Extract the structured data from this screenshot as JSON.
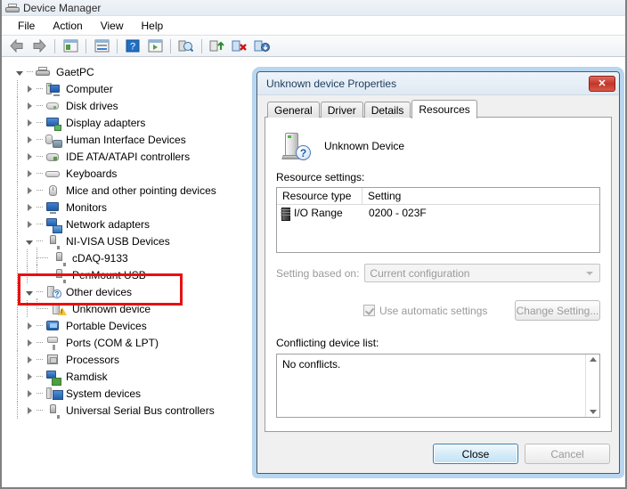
{
  "window": {
    "title": "Device Manager",
    "icon": "printer-device-icon",
    "menus": [
      "File",
      "Action",
      "View",
      "Help"
    ],
    "toolbar": [
      {
        "name": "back-button",
        "icon": "left-arrow-icon"
      },
      {
        "name": "forward-button",
        "icon": "right-arrow-icon"
      },
      {
        "name": "separator-1",
        "icon": "separator"
      },
      {
        "name": "show-hide-console-tree-button",
        "icon": "console-tree-icon"
      },
      {
        "name": "separator-2",
        "icon": "separator"
      },
      {
        "name": "properties-button",
        "icon": "properties-window-icon"
      },
      {
        "name": "separator-3",
        "icon": "separator"
      },
      {
        "name": "help-button",
        "icon": "help-question-icon"
      },
      {
        "name": "show-hide-action-pane-button",
        "icon": "action-pane-icon"
      },
      {
        "name": "separator-4",
        "icon": "separator"
      },
      {
        "name": "scan-for-hardware-changes-button",
        "icon": "scan-magnifier-icon"
      },
      {
        "name": "separator-5",
        "icon": "separator"
      },
      {
        "name": "update-driver-button",
        "icon": "update-driver-icon"
      },
      {
        "name": "uninstall-device-button",
        "icon": "uninstall-device-icon"
      },
      {
        "name": "disable-device-button",
        "icon": "disable-device-icon"
      }
    ]
  },
  "tree": {
    "root": {
      "label": "GaetPC",
      "icon": "computer-printer-icon",
      "expanded": true
    },
    "items": [
      {
        "label": "Computer",
        "icon": "computer-icon",
        "state": "collapsed",
        "level": 1
      },
      {
        "label": "Disk drives",
        "icon": "disk-drive-icon",
        "state": "collapsed",
        "level": 1
      },
      {
        "label": "Display adapters",
        "icon": "display-adapter-icon",
        "state": "collapsed",
        "level": 1
      },
      {
        "label": "Human Interface Devices",
        "icon": "hid-icon",
        "state": "collapsed",
        "level": 1
      },
      {
        "label": "IDE ATA/ATAPI controllers",
        "icon": "ide-controller-icon",
        "state": "collapsed",
        "level": 1
      },
      {
        "label": "Keyboards",
        "icon": "keyboard-icon",
        "state": "collapsed",
        "level": 1
      },
      {
        "label": "Mice and other pointing devices",
        "icon": "mouse-icon",
        "state": "collapsed",
        "level": 1
      },
      {
        "label": "Monitors",
        "icon": "monitor-icon",
        "state": "collapsed",
        "level": 1
      },
      {
        "label": "Network adapters",
        "icon": "network-adapter-icon",
        "state": "collapsed",
        "level": 1
      },
      {
        "label": "NI-VISA USB Devices",
        "icon": "usb-device-icon",
        "state": "expanded",
        "level": 1
      },
      {
        "label": "cDAQ-9133",
        "icon": "usb-device-icon",
        "state": "leaf",
        "level": 2
      },
      {
        "label": "PenMount USB",
        "icon": "usb-device-icon",
        "state": "leaf-last",
        "level": 2
      },
      {
        "label": "Other devices",
        "icon": "other-device-question-icon",
        "state": "expanded",
        "level": 1,
        "highlighted": true
      },
      {
        "label": "Unknown device",
        "icon": "unknown-device-warning-icon",
        "state": "leaf-last",
        "level": 2,
        "highlighted": true
      },
      {
        "label": "Portable Devices",
        "icon": "portable-device-icon",
        "state": "collapsed",
        "level": 1
      },
      {
        "label": "Ports (COM & LPT)",
        "icon": "port-icon",
        "state": "collapsed",
        "level": 1
      },
      {
        "label": "Processors",
        "icon": "processor-icon",
        "state": "collapsed",
        "level": 1
      },
      {
        "label": "Ramdisk",
        "icon": "ramdisk-icon",
        "state": "collapsed",
        "level": 1
      },
      {
        "label": "System devices",
        "icon": "system-device-icon",
        "state": "collapsed",
        "level": 1
      },
      {
        "label": "Universal Serial Bus controllers",
        "icon": "usb-controller-icon",
        "state": "collapsed",
        "level": 1
      }
    ]
  },
  "annotation": {
    "name": "red-highlight-box",
    "color": "#e81010"
  },
  "dialog": {
    "title": "Unknown device Properties",
    "close_label": "✕",
    "tabs": [
      {
        "label": "General",
        "active": false
      },
      {
        "label": "Driver",
        "active": false
      },
      {
        "label": "Details",
        "active": false
      },
      {
        "label": "Resources",
        "active": true
      }
    ],
    "device_name": "Unknown Device",
    "device_icon": "unknown-device-question-icon",
    "resource_settings_label": "Resource settings:",
    "resource_table": {
      "columns": [
        "Resource type",
        "Setting"
      ],
      "rows": [
        {
          "type": "I/O Range",
          "setting": "0200 - 023F",
          "icon": "io-range-icon"
        }
      ]
    },
    "setting_based_on_label": "Setting based on:",
    "setting_based_on_value": "Current configuration",
    "use_automatic_settings_label": "Use automatic settings",
    "use_automatic_settings_checked": true,
    "change_setting_label": "Change Setting...",
    "conflicting_device_list_label": "Conflicting device list:",
    "conflicting_device_list_text": "No conflicts.",
    "close_button_label": "Close",
    "cancel_button_label": "Cancel"
  }
}
